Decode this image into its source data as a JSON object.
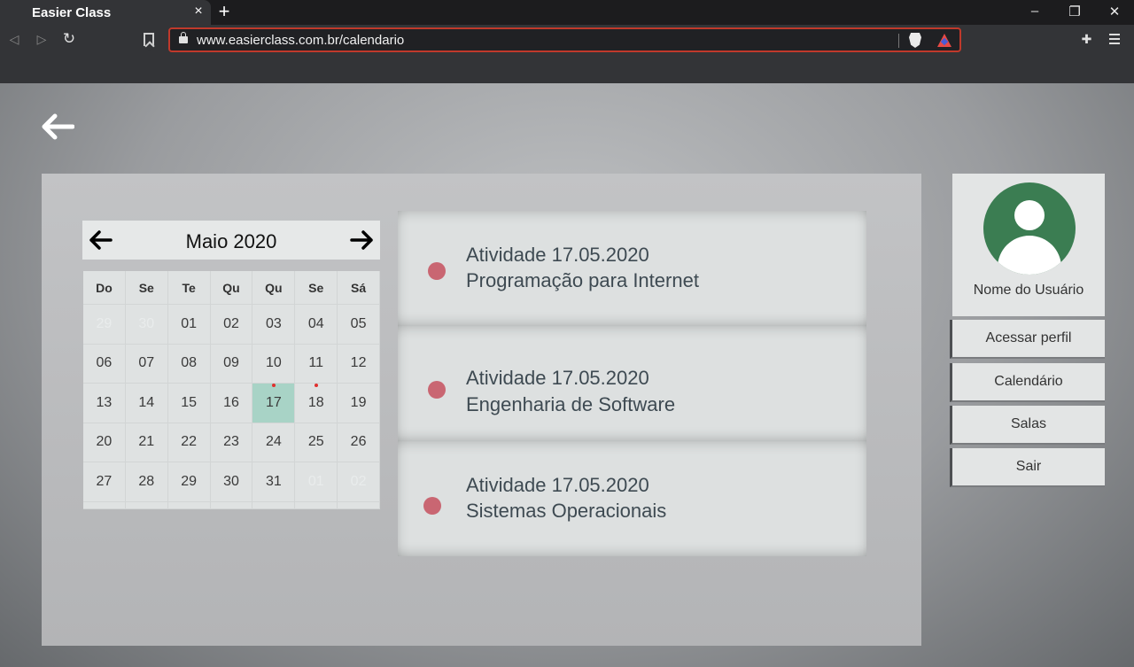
{
  "browser": {
    "tab_title": "Easier Class",
    "tab_close": "×",
    "new_tab": "+",
    "url": "www.easierclass.com.br/calendario",
    "window": {
      "minimize": "–",
      "restore": "❐",
      "close": "✕"
    },
    "nav": {
      "back": "◁",
      "forward": "▷",
      "reload": "↻"
    },
    "extension_glyph": "✚"
  },
  "calendar": {
    "month_title": "Maio 2020",
    "weekdays": [
      "Do",
      "Se",
      "Te",
      "Qu",
      "Qu",
      "Se",
      "Sá"
    ],
    "weeks": [
      [
        "29",
        "30",
        "01",
        "02",
        "03",
        "04",
        "05"
      ],
      [
        "06",
        "07",
        "08",
        "09",
        "10",
        "11",
        "12"
      ],
      [
        "13",
        "14",
        "15",
        "16",
        "17",
        "18",
        "19"
      ],
      [
        "20",
        "21",
        "22",
        "23",
        "24",
        "25",
        "26"
      ],
      [
        "27",
        "28",
        "29",
        "30",
        "31",
        "01",
        "02"
      ]
    ],
    "selected_day": "17",
    "accent_color": "#a8d3c6"
  },
  "activities": [
    {
      "title": "Atividade 17.05.2020",
      "subject": "Programação para Internet"
    },
    {
      "title": "Atividade 17.05.2020",
      "subject": "Engenharia de Software"
    },
    {
      "title": "Atividade 17.05.2020",
      "subject": "Sistemas Operacionais"
    }
  ],
  "sidebar": {
    "user_name": "Nome do Usuário",
    "avatar_color": "#3b7d52",
    "buttons": [
      "Acessar perfil",
      "Calendário",
      "Salas",
      "Sair"
    ]
  }
}
